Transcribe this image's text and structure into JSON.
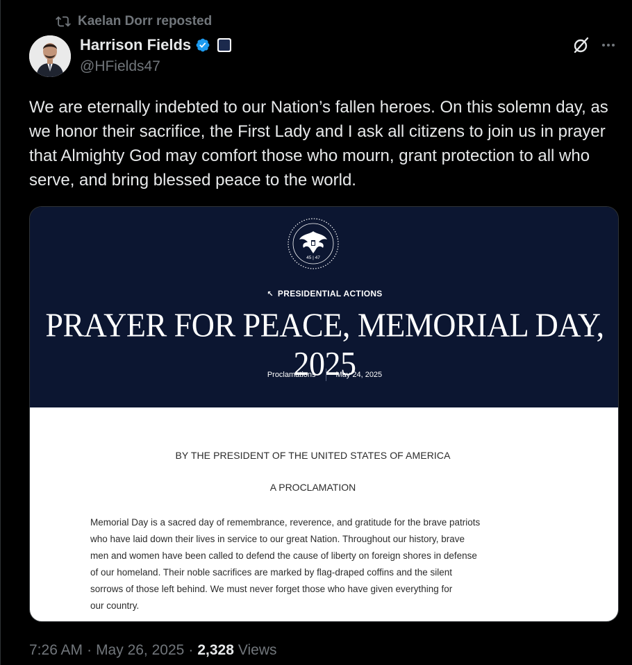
{
  "repost": {
    "text": "Kaelan Dorr reposted"
  },
  "author": {
    "name": "Harrison Fields",
    "handle": "@HFields47"
  },
  "tweet": {
    "text": "We are eternally indebted to our Nation’s fallen heroes.  On this solemn day, as we honor their sacrifice, the First Lady and I ask all citizens to join us in prayer that Almighty God may comfort those who mourn, grant protection to all who serve, and bring blessed peace to the world."
  },
  "card": {
    "seal_text": "45 | 47",
    "kicker": "PRESIDENTIAL ACTIONS",
    "title": "PRAYER FOR PEACE, MEMORIAL DAY, 2025",
    "category": "Proclamations",
    "date": "May 24, 2025",
    "by_line": "BY THE PRESIDENT OF THE UNITED STATES OF AMERICA",
    "proclamation_heading": "A PROCLAMATION",
    "paragraph": "Memorial Day is a sacred day of remembrance, reverence, and gratitude for the brave patriots\nwho have laid down their lives in service to our great Nation.  Throughout our history, brave\nmen and women have been called to defend the cause of liberty on foreign shores in defense\nof our homeland.  Their noble sacrifices are marked by flag-draped coffins and the silent\nsorrows of those left behind.  We must never forget those who have given everything for\nour country."
  },
  "footer": {
    "time": "7:26 AM",
    "date": "May 26, 2025",
    "views_count": "2,328",
    "views_label": "Views"
  },
  "colors": {
    "background": "#000000",
    "text_primary": "#e7e9ea",
    "text_secondary": "#71767b",
    "verified_blue": "#1d9bf0",
    "card_header": "#0c1631"
  },
  "icons": {
    "repost": "repost-icon",
    "verified": "verified-badge-icon",
    "affiliation": "white-house-badge-icon",
    "grok": "grok-icon",
    "more": "more-icon"
  }
}
